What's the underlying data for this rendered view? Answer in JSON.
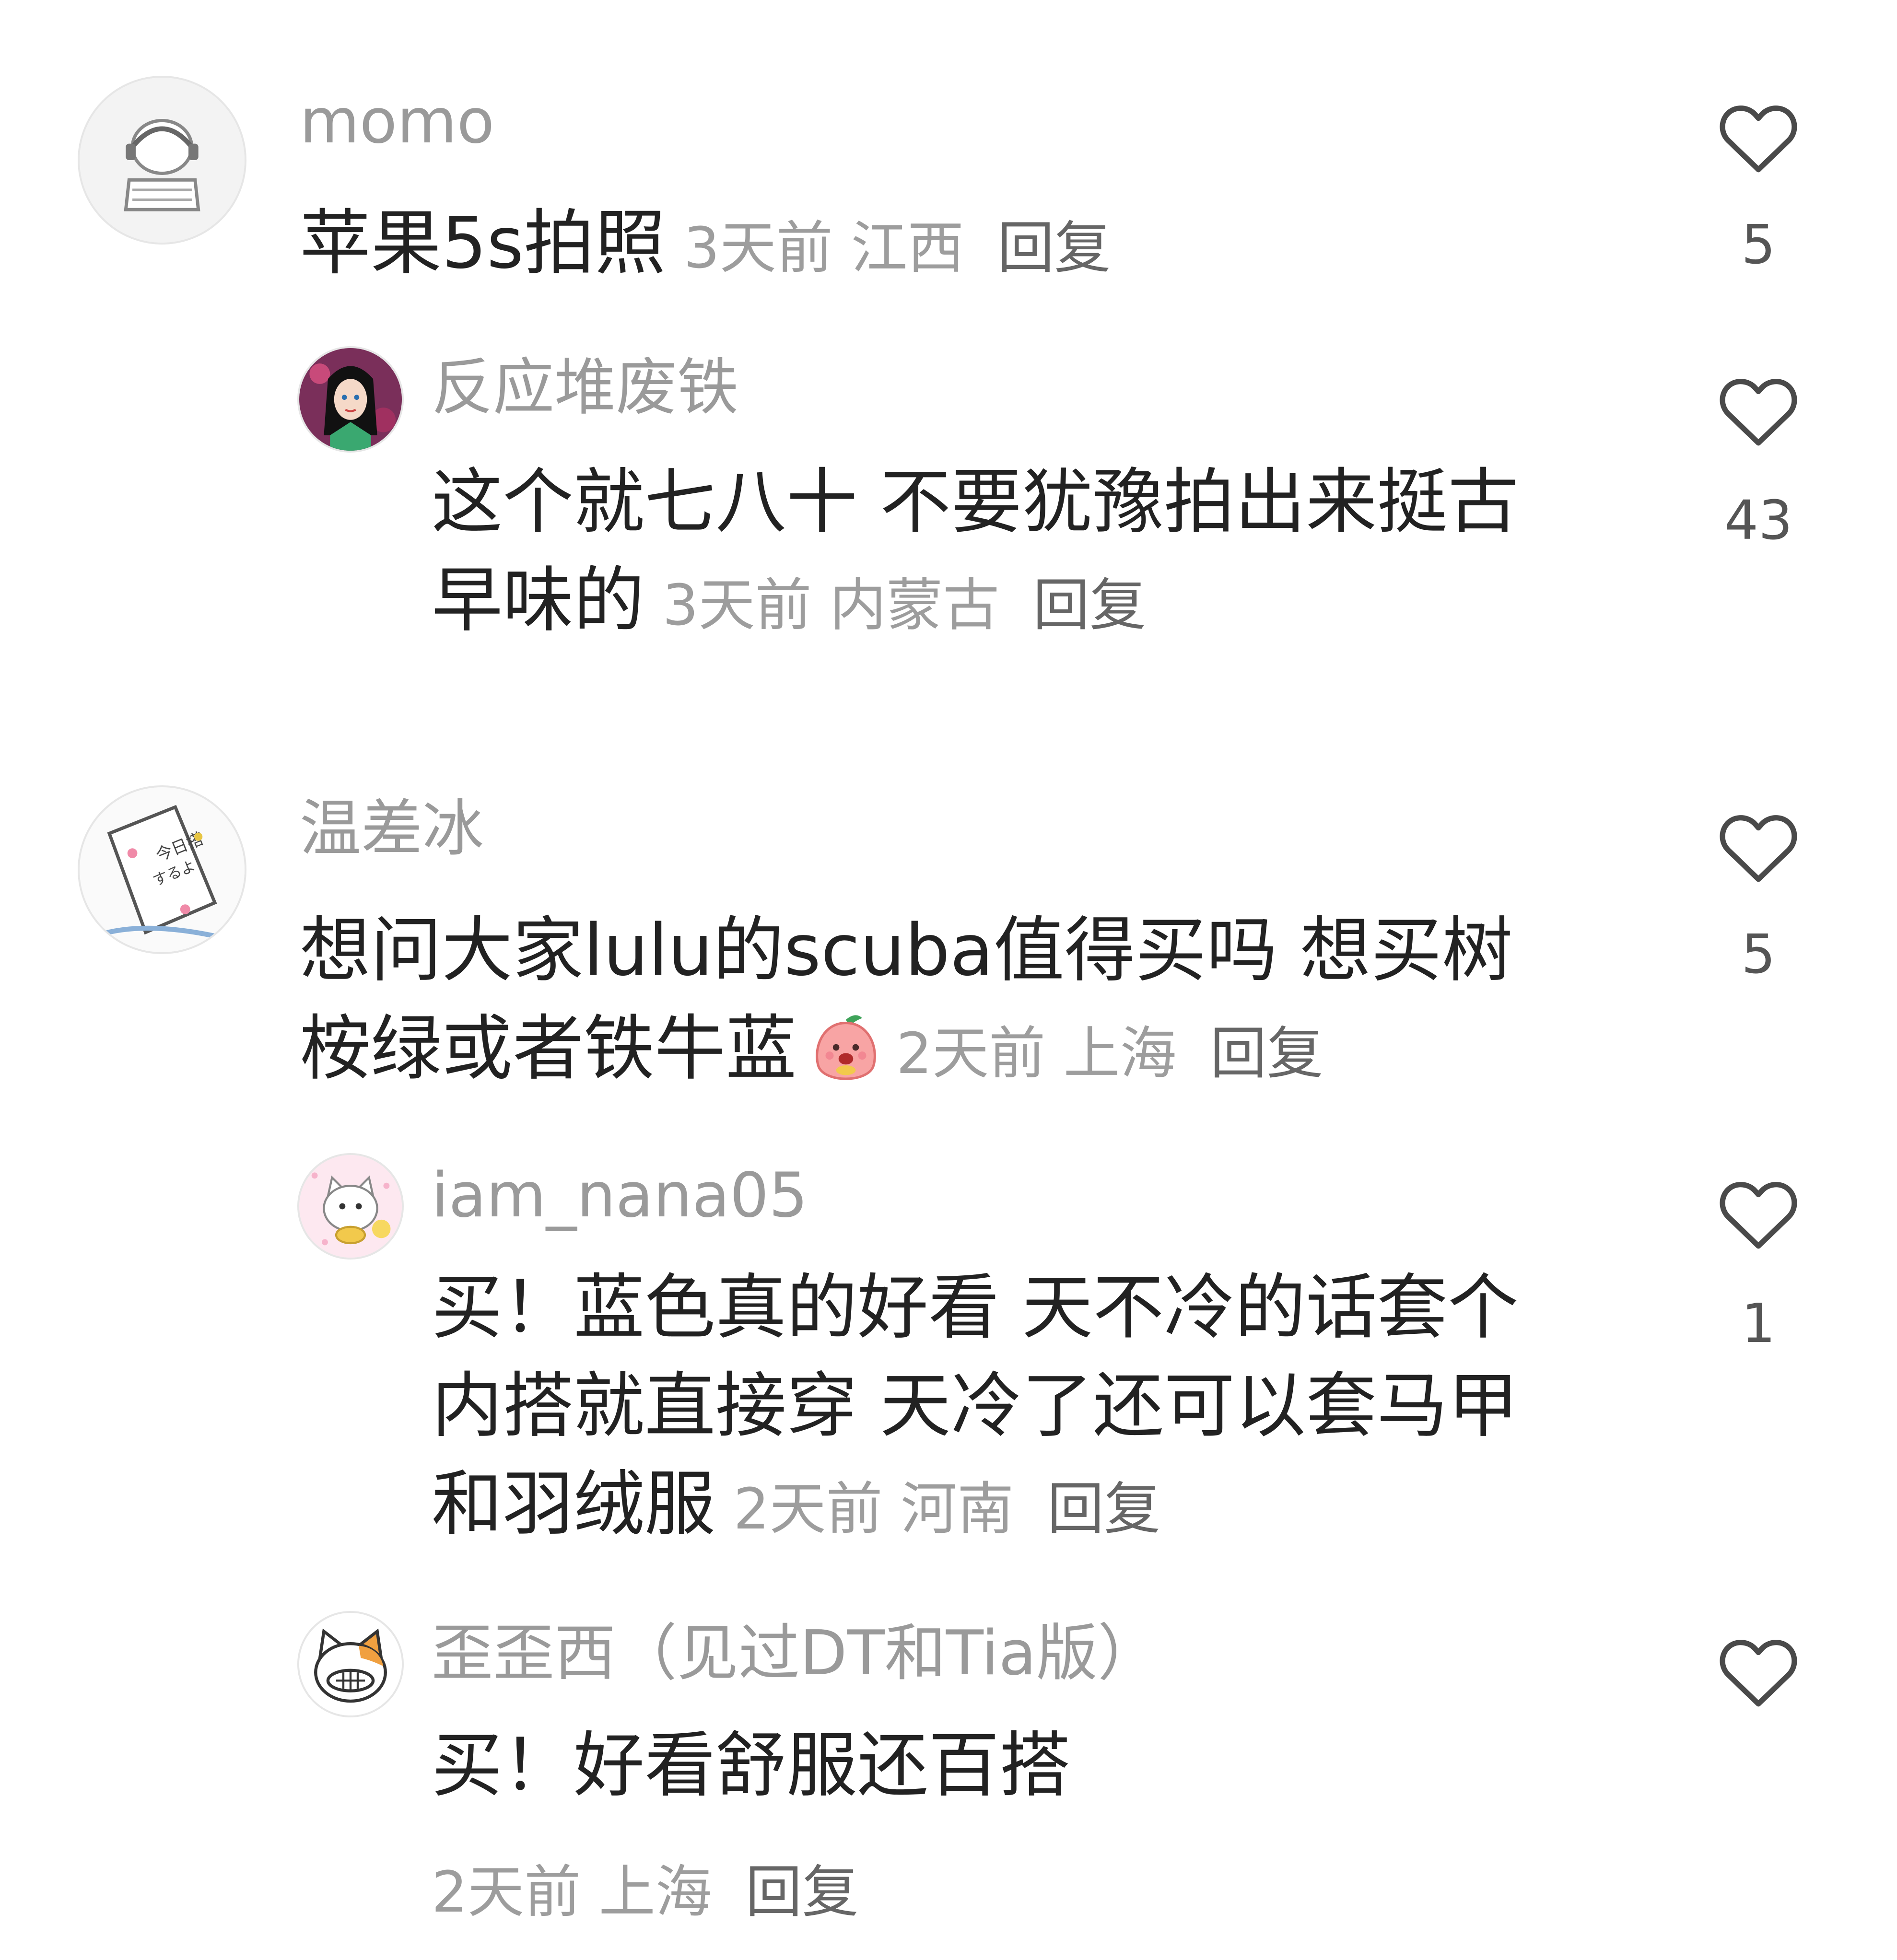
{
  "comments": [
    {
      "username": "momo",
      "text": "苹果5s拍照",
      "time": "3天前",
      "location": "江西",
      "reply_label": "回复",
      "likes": "5"
    },
    {
      "username": "反应堆废铁",
      "text": "这个就七八十 不要犹豫拍出来挺古早味的",
      "time": "3天前",
      "location": "内蒙古",
      "reply_label": "回复",
      "likes": "43"
    },
    {
      "username": "温差冰",
      "text": "想问大家lulu的scuba值得买吗 想买树桉绿或者铁牛蓝",
      "time": "2天前",
      "location": "上海",
      "reply_label": "回复",
      "likes": "5"
    },
    {
      "username": "iam_nana05",
      "text": "买！蓝色真的好看 天不冷的话套个内搭就直接穿 天冷了还可以套马甲和羽绒服",
      "time": "2天前",
      "location": "河南",
      "reply_label": "回复",
      "likes": "1"
    },
    {
      "username": "歪歪西（见过DT和Tia版）",
      "text": "买！好看舒服还百搭",
      "time": "2天前",
      "location": "上海",
      "reply_label": "回复",
      "likes": ""
    }
  ],
  "icons": {
    "like": "heart-outline-icon",
    "emoji": "peach-emoji-icon"
  },
  "colors": {
    "username": "#9a9a9a",
    "text": "#222222",
    "meta": "#9d9d9d",
    "icon": "#4a4a4a"
  }
}
